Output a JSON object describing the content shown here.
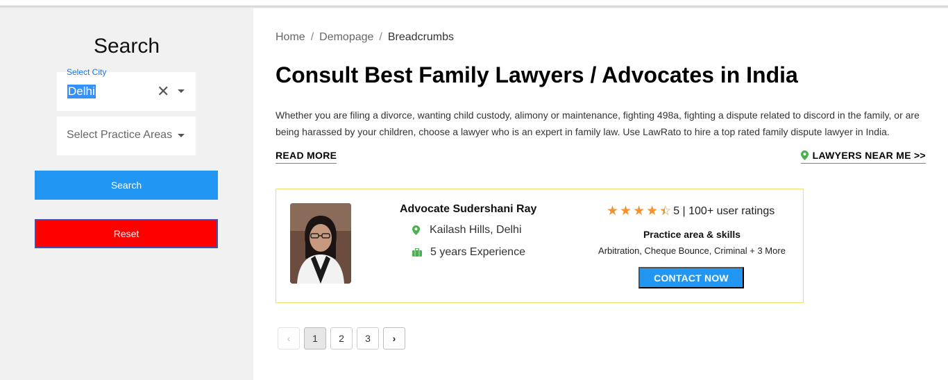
{
  "sidebar": {
    "title": "Search",
    "city_label": "Select City",
    "city_value": "Delhi",
    "practice_placeholder": "Select Practice Areas",
    "search_label": "Search",
    "reset_label": "Reset"
  },
  "breadcrumb": [
    "Home",
    "Demopage",
    "Breadcrumbs"
  ],
  "page_title": "Consult Best Family Lawyers / Advocates in India",
  "intro": "Whether you are filing a divorce, wanting child custody, alimony or maintenance, fighting 498a, fighting a dispute related to discord in the family, or are being harassed by your children, choose a lawyer who is an expert in family law. Use LawRato to hire a top rated family dispute lawyer in India.",
  "links": {
    "read_more": "READ MORE",
    "near_me": "LAWYERS NEAR ME >>"
  },
  "lawyer": {
    "name": "Advocate Sudershani Ray",
    "location": "Kailash Hills, Delhi",
    "experience": "5 years Experience",
    "stars": 4.5,
    "rating_text": "5 | 100+ user ratings",
    "skills_title": "Practice area & skills",
    "skills": "Arbitration, Cheque Bounce, Criminal + 3 More",
    "contact_label": "CONTACT NOW"
  },
  "pagination": {
    "prev": "‹",
    "pages": [
      "1",
      "2",
      "3"
    ],
    "current": "1",
    "next": "›"
  },
  "colors": {
    "accent": "#2196f3",
    "reset": "#ff0000",
    "star": "#f5922e",
    "icon_green": "#4caf50",
    "card_border": "#f3dc6a"
  }
}
